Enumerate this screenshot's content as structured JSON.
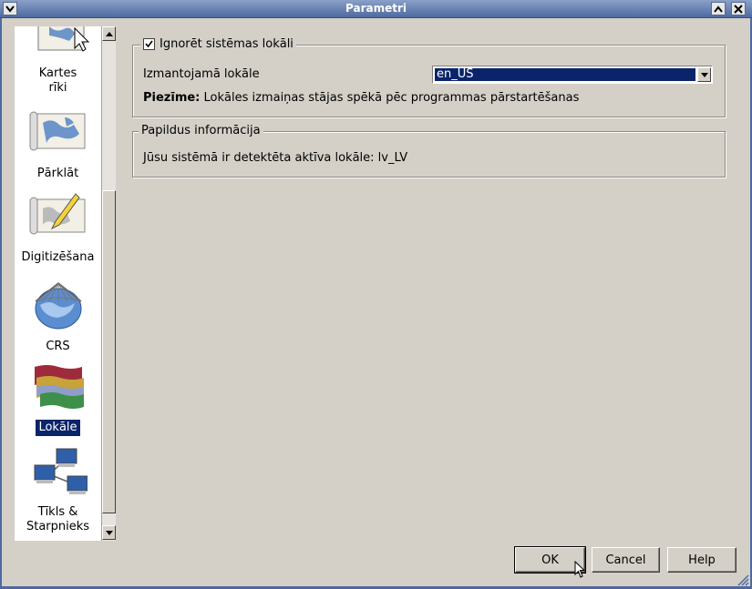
{
  "window": {
    "title": "Parametri"
  },
  "sidebar": {
    "items": [
      {
        "id": "map-tools",
        "label_line1": "Kartes",
        "label_line2": "rīki",
        "icon": "map-tools-icon"
      },
      {
        "id": "overlay",
        "label": "Pārklāt",
        "icon": "overlay-map-icon"
      },
      {
        "id": "digitizing",
        "label": "Digitizēšana",
        "icon": "digitizing-pencil-icon"
      },
      {
        "id": "crs",
        "label": "CRS",
        "icon": "globe-icon"
      },
      {
        "id": "locale",
        "label": "Lokāle",
        "icon": "flags-icon",
        "selected": true
      },
      {
        "id": "network",
        "label_line1": "Tīkls &",
        "label_line2": "Starpnieks",
        "icon": "network-computers-icon"
      }
    ]
  },
  "locale_group": {
    "checkbox_label": "Ignorēt sistēmas lokāli",
    "checked": true,
    "locale_label": "Izmantojamā lokāle",
    "locale_value": "en_US",
    "note_bold": "Piezīme:",
    "note_text": " Lokāles izmaiņas stājas spēkā pēc programmas pārstartēšanas"
  },
  "info_group": {
    "title": "Papildus informācija",
    "detected_text": "Jūsu sistēmā ir detektēta aktīva lokāle: lv_LV"
  },
  "buttons": {
    "ok": "OK",
    "cancel": "Cancel",
    "help": "Help"
  },
  "colors": {
    "titlebar": "#4e6aa0",
    "selection": "#0a246a",
    "dialog_bg": "#d4d0c8"
  }
}
